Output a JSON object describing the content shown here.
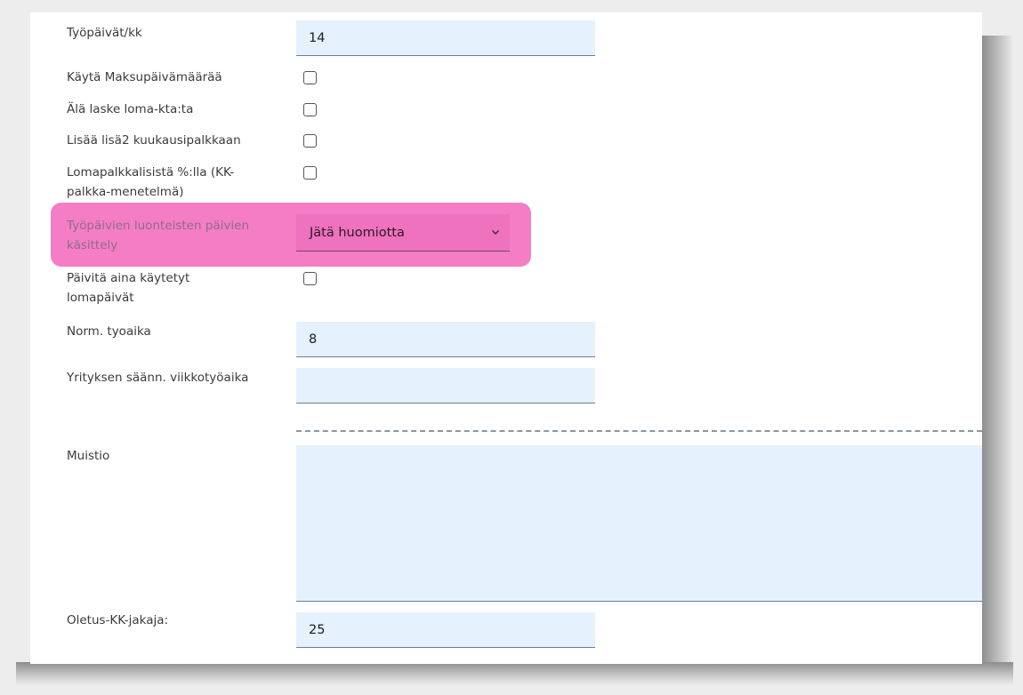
{
  "form": {
    "workdays_per_month": {
      "label": "Työpäivät/kk",
      "value": "14"
    },
    "use_payment_date": {
      "label": "Käytä Maksupäivämäärää",
      "checked": false
    },
    "dont_count_holiday_avg": {
      "label": "Älä laske loma-kta:ta",
      "checked": false
    },
    "add_lisa2_monthly": {
      "label": "Lisää lisä2 kuukausipalkkaan",
      "checked": false
    },
    "holiday_pay_percent": {
      "label_line1": "Lomapalkkalisistä %:lla (KK-",
      "label_line2": "palkka-menetelmä)",
      "checked": false
    },
    "natural_days_handling": {
      "label_line1": "Työpäivien luonteisten päivien",
      "label_line2": "käsittely",
      "selected": "Jätä huomiotta",
      "highlight_color": "#f47dc6"
    },
    "always_update_used_holidays": {
      "label_line1": "Päivitä aina käytetyt",
      "label_line2": "lomapäivät",
      "checked": false
    },
    "normal_work_time": {
      "label": "Norm. tyoaika",
      "value": "8"
    },
    "company_weekly_hours": {
      "label": "Yrityksen säänn. viikkotyöaika",
      "value": ""
    },
    "memo": {
      "label": "Muistio",
      "value": ""
    },
    "default_monthly_divisor": {
      "label": "Oletus-KK-jakaja:",
      "value": "25"
    }
  },
  "icons": {
    "select_arrow": "chevron-down-icon"
  },
  "colors": {
    "field_bg": "#e5f1fc",
    "highlight": "#f47dc6"
  }
}
